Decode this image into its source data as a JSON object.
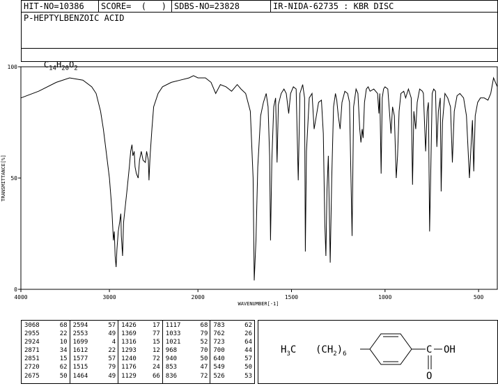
{
  "header": {
    "hit_no": "HIT-NO=10386",
    "score": "SCORE=  (   )",
    "sdbs_no": "SDBS-NO=23828",
    "ir_info": "IR-NIDA-62735 : KBR DISC",
    "compound": "P-HEPTYLBENZOIC ACID",
    "formula_parts": [
      "C",
      "14",
      "H",
      "20",
      "O",
      "2"
    ]
  },
  "chart_data": {
    "type": "line",
    "xlabel": "WAVENUMBER[-1]",
    "ylabel": "TRANSMITTANCE[%]",
    "xlim": [
      4000,
      400
    ],
    "ylim": [
      0,
      100
    ],
    "x_ticks": [
      "4000",
      "3000",
      "2000",
      "1500",
      "1000",
      "500"
    ],
    "y_ticks": [
      "100",
      "50",
      "0"
    ],
    "line_color": "#000000",
    "series": [
      {
        "points": [
          [
            4000,
            86
          ],
          [
            3800,
            89
          ],
          [
            3600,
            93
          ],
          [
            3450,
            95
          ],
          [
            3300,
            94
          ],
          [
            3200,
            91
          ],
          [
            3150,
            88
          ],
          [
            3100,
            80
          ],
          [
            3068,
            72
          ],
          [
            3040,
            63
          ],
          [
            3000,
            50
          ],
          [
            2980,
            40
          ],
          [
            2970,
            34
          ],
          [
            2955,
            22
          ],
          [
            2945,
            26
          ],
          [
            2935,
            15
          ],
          [
            2924,
            10
          ],
          [
            2915,
            18
          ],
          [
            2900,
            26
          ],
          [
            2885,
            30
          ],
          [
            2871,
            34
          ],
          [
            2865,
            24
          ],
          [
            2851,
            15
          ],
          [
            2840,
            30
          ],
          [
            2800,
            45
          ],
          [
            2775,
            55
          ],
          [
            2760,
            62
          ],
          [
            2745,
            65
          ],
          [
            2735,
            60
          ],
          [
            2720,
            62
          ],
          [
            2710,
            55
          ],
          [
            2695,
            52
          ],
          [
            2675,
            50
          ],
          [
            2660,
            58
          ],
          [
            2640,
            62
          ],
          [
            2620,
            58
          ],
          [
            2594,
            57
          ],
          [
            2580,
            62
          ],
          [
            2560,
            58
          ],
          [
            2553,
            49
          ],
          [
            2540,
            60
          ],
          [
            2520,
            72
          ],
          [
            2500,
            82
          ],
          [
            2450,
            88
          ],
          [
            2400,
            91
          ],
          [
            2300,
            93
          ],
          [
            2200,
            94
          ],
          [
            2100,
            95
          ],
          [
            2050,
            96
          ],
          [
            2000,
            95
          ],
          [
            1960,
            95
          ],
          [
            1930,
            93
          ],
          [
            1905,
            88
          ],
          [
            1880,
            92
          ],
          [
            1850,
            91
          ],
          [
            1820,
            89
          ],
          [
            1790,
            92
          ],
          [
            1770,
            90
          ],
          [
            1745,
            88
          ],
          [
            1720,
            80
          ],
          [
            1705,
            50
          ],
          [
            1699,
            4
          ],
          [
            1690,
            22
          ],
          [
            1680,
            55
          ],
          [
            1665,
            78
          ],
          [
            1650,
            84
          ],
          [
            1635,
            88
          ],
          [
            1625,
            82
          ],
          [
            1617,
            60
          ],
          [
            1612,
            22
          ],
          [
            1605,
            58
          ],
          [
            1595,
            82
          ],
          [
            1585,
            86
          ],
          [
            1577,
            57
          ],
          [
            1570,
            83
          ],
          [
            1555,
            88
          ],
          [
            1540,
            90
          ],
          [
            1528,
            88
          ],
          [
            1515,
            79
          ],
          [
            1505,
            88
          ],
          [
            1490,
            91
          ],
          [
            1475,
            90
          ],
          [
            1464,
            49
          ],
          [
            1455,
            88
          ],
          [
            1440,
            92
          ],
          [
            1430,
            86
          ],
          [
            1426,
            17
          ],
          [
            1420,
            62
          ],
          [
            1405,
            86
          ],
          [
            1390,
            88
          ],
          [
            1379,
            72
          ],
          [
            1369,
            77
          ],
          [
            1355,
            84
          ],
          [
            1340,
            85
          ],
          [
            1330,
            70
          ],
          [
            1322,
            30
          ],
          [
            1316,
            15
          ],
          [
            1310,
            45
          ],
          [
            1303,
            60
          ],
          [
            1293,
            12
          ],
          [
            1285,
            50
          ],
          [
            1275,
            82
          ],
          [
            1265,
            88
          ],
          [
            1258,
            85
          ],
          [
            1250,
            78
          ],
          [
            1240,
            72
          ],
          [
            1230,
            84
          ],
          [
            1215,
            89
          ],
          [
            1200,
            88
          ],
          [
            1190,
            84
          ],
          [
            1176,
            24
          ],
          [
            1168,
            82
          ],
          [
            1155,
            90
          ],
          [
            1145,
            88
          ],
          [
            1135,
            72
          ],
          [
            1129,
            66
          ],
          [
            1122,
            72
          ],
          [
            1117,
            68
          ],
          [
            1110,
            84
          ],
          [
            1100,
            90
          ],
          [
            1090,
            91
          ],
          [
            1080,
            89
          ],
          [
            1060,
            90
          ],
          [
            1040,
            88
          ],
          [
            1033,
            79
          ],
          [
            1028,
            88
          ],
          [
            1021,
            52
          ],
          [
            1015,
            86
          ],
          [
            1008,
            90
          ],
          [
            1000,
            91
          ],
          [
            985,
            90
          ],
          [
            968,
            70
          ],
          [
            960,
            82
          ],
          [
            950,
            78
          ],
          [
            940,
            50
          ],
          [
            933,
            60
          ],
          [
            925,
            80
          ],
          [
            915,
            88
          ],
          [
            900,
            89
          ],
          [
            890,
            86
          ],
          [
            875,
            90
          ],
          [
            860,
            86
          ],
          [
            853,
            47
          ],
          [
            846,
            80
          ],
          [
            836,
            72
          ],
          [
            828,
            84
          ],
          [
            815,
            90
          ],
          [
            800,
            89
          ],
          [
            795,
            88
          ],
          [
            783,
            62
          ],
          [
            775,
            80
          ],
          [
            768,
            84
          ],
          [
            762,
            26
          ],
          [
            755,
            55
          ],
          [
            748,
            88
          ],
          [
            740,
            90
          ],
          [
            730,
            89
          ],
          [
            723,
            64
          ],
          [
            715,
            80
          ],
          [
            705,
            86
          ],
          [
            700,
            44
          ],
          [
            693,
            75
          ],
          [
            680,
            88
          ],
          [
            665,
            86
          ],
          [
            650,
            82
          ],
          [
            640,
            57
          ],
          [
            630,
            80
          ],
          [
            615,
            87
          ],
          [
            600,
            88
          ],
          [
            580,
            86
          ],
          [
            565,
            78
          ],
          [
            549,
            50
          ],
          [
            542,
            62
          ],
          [
            533,
            76
          ],
          [
            526,
            53
          ],
          [
            518,
            78
          ],
          [
            505,
            84
          ],
          [
            490,
            86
          ],
          [
            470,
            86
          ],
          [
            450,
            85
          ],
          [
            435,
            88
          ],
          [
            420,
            95
          ],
          [
            400,
            91
          ]
        ]
      }
    ]
  },
  "peak_table": [
    [
      [
        "3068",
        "68"
      ],
      [
        "2955",
        "22"
      ],
      [
        "2924",
        "10"
      ],
      [
        "2871",
        "34"
      ],
      [
        "2851",
        "15"
      ],
      [
        "2720",
        "62"
      ],
      [
        "2675",
        "50"
      ]
    ],
    [
      [
        "2594",
        "57"
      ],
      [
        "2553",
        "49"
      ],
      [
        "1699",
        "4"
      ],
      [
        "1612",
        "22"
      ],
      [
        "1577",
        "57"
      ],
      [
        "1515",
        "79"
      ],
      [
        "1464",
        "49"
      ]
    ],
    [
      [
        "1426",
        "17"
      ],
      [
        "1369",
        "77"
      ],
      [
        "1316",
        "15"
      ],
      [
        "1293",
        "12"
      ],
      [
        "1240",
        "72"
      ],
      [
        "1176",
        "24"
      ],
      [
        "1129",
        "66"
      ]
    ],
    [
      [
        "1117",
        "68"
      ],
      [
        "1033",
        "79"
      ],
      [
        "1021",
        "52"
      ],
      [
        "968",
        "70"
      ],
      [
        "940",
        "50"
      ],
      [
        "853",
        "47"
      ],
      [
        "836",
        "72"
      ]
    ],
    [
      [
        "783",
        "62"
      ],
      [
        "762",
        "26"
      ],
      [
        "723",
        "64"
      ],
      [
        "700",
        "44"
      ],
      [
        "640",
        "57"
      ],
      [
        "549",
        "50"
      ],
      [
        "526",
        "53"
      ]
    ]
  ],
  "structure": {
    "left_group": "H",
    "left_sub": "3",
    "left_c": "C",
    "chain_open": "(CH",
    "chain_sub": "2",
    "chain_close": ")",
    "repeat": "6",
    "carbon": "C",
    "oh": "OH",
    "oxygen": "O"
  }
}
